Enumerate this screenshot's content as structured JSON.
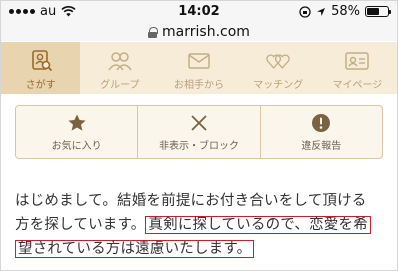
{
  "status_bar": {
    "carrier": "au",
    "time": "14:02",
    "battery": "58%",
    "battery_level": 0.58
  },
  "browser": {
    "url": "marrish.com"
  },
  "nav": {
    "items": [
      {
        "label": "さがす",
        "icon": "search-person-icon",
        "active": true
      },
      {
        "label": "グループ",
        "icon": "group-icon",
        "active": false
      },
      {
        "label": "お相手から",
        "icon": "mail-icon",
        "active": false
      },
      {
        "label": "マッチング",
        "icon": "hearts-icon",
        "active": false
      },
      {
        "label": "マイページ",
        "icon": "profile-card-icon",
        "active": false
      }
    ]
  },
  "actions": {
    "favorite": "お気に入り",
    "hide_block": "非表示・ブロック",
    "report": "違反報告"
  },
  "message": {
    "line1": "はじめまして。結婚を前提にお付き合いをして頂ける",
    "line2_plain": "方を探しています。",
    "line2_highlight": "真剣に探しているので、恋愛を希",
    "line3_highlight": "望されている方は遠慮いたします。"
  },
  "colors": {
    "nav_bg": "#f6ecd8",
    "nav_active_bg": "#e8d5b0",
    "accent": "#9b6a2a",
    "highlight_border": "#c8202a"
  }
}
